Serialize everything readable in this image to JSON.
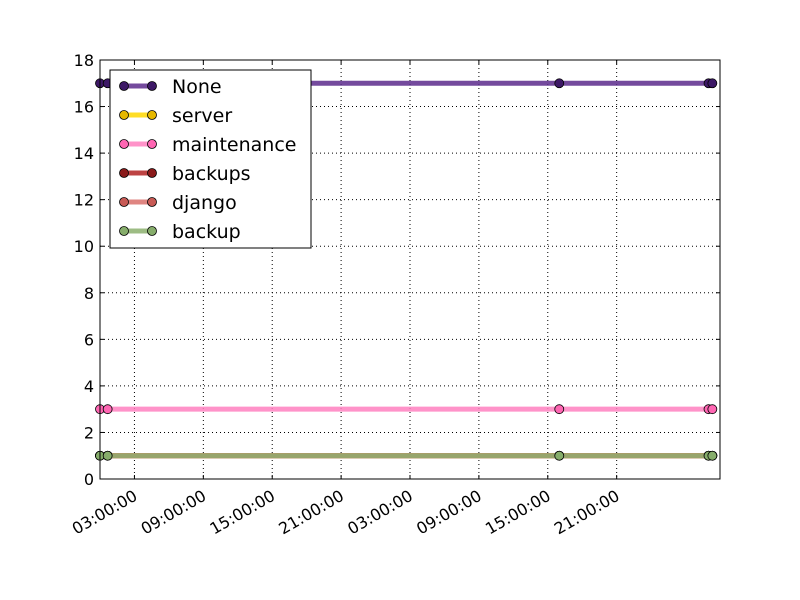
{
  "chart_data": {
    "type": "line",
    "title": "",
    "xlabel": "",
    "ylabel": "",
    "grid": true,
    "legend_position": "top-left",
    "ylim": [
      0,
      18
    ],
    "y_ticks": [
      0,
      2,
      4,
      6,
      8,
      10,
      12,
      14,
      16,
      18
    ],
    "xlim": [
      "2013-03-01T00:00:00",
      "2013-03-03T06:00:00"
    ],
    "x_ticks": [
      {
        "value": "2013-03-01T03:00:00",
        "label": "03:00:00"
      },
      {
        "value": "2013-03-01T09:00:00",
        "label": "09:00:00"
      },
      {
        "value": "2013-03-01T15:00:00",
        "label": "15:00:00"
      },
      {
        "value": "2013-03-01T21:00:00",
        "label": "21:00:00"
      },
      {
        "value": "2013-03-02T03:00:00",
        "label": "03:00:00"
      },
      {
        "value": "2013-03-02T09:00:00",
        "label": "09:00:00"
      },
      {
        "value": "2013-03-02T15:00:00",
        "label": "15:00:00"
      },
      {
        "value": "2013-03-02T21:00:00",
        "label": "21:00:00"
      }
    ],
    "series": [
      {
        "name": "None",
        "color": "#5c2a8c",
        "marker": "#3d1866",
        "x": [
          "2013-03-01T00:00:00",
          "2013-03-01T00:40:00",
          "2013-03-02T16:00:00",
          "2013-03-03T05:00:00",
          "2013-03-03T05:20:00"
        ],
        "y": [
          17,
          17,
          17,
          17,
          17
        ]
      },
      {
        "name": "server",
        "color": "#ffd700",
        "marker": "#e6b800",
        "x": [
          "2013-03-01T00:00:00",
          "2013-03-01T00:40:00",
          "2013-03-02T16:00:00",
          "2013-03-03T05:00:00",
          "2013-03-03T05:20:00"
        ],
        "y": [
          1,
          1,
          1,
          1,
          1
        ]
      },
      {
        "name": "maintenance",
        "color": "#ff80c0",
        "marker": "#ff66b3",
        "x": [
          "2013-03-01T00:00:00",
          "2013-03-01T00:40:00",
          "2013-03-02T16:00:00",
          "2013-03-03T05:00:00",
          "2013-03-03T05:20:00"
        ],
        "y": [
          3,
          3,
          3,
          3,
          3
        ]
      },
      {
        "name": "backups",
        "color": "#b22222",
        "marker": "#8b1a1a",
        "x": [
          "2013-03-01T00:00:00",
          "2013-03-01T00:40:00",
          "2013-03-02T16:00:00",
          "2013-03-03T05:00:00",
          "2013-03-03T05:20:00"
        ],
        "y": [
          1,
          1,
          1,
          1,
          1
        ]
      },
      {
        "name": "django",
        "color": "#d9706b",
        "marker": "#c85a55",
        "x": [
          "2013-03-01T00:00:00",
          "2013-03-01T00:40:00",
          "2013-03-02T16:00:00",
          "2013-03-03T05:00:00",
          "2013-03-03T05:20:00"
        ],
        "y": [
          1,
          1,
          1,
          1,
          1
        ]
      },
      {
        "name": "backup",
        "color": "#8cb06e",
        "marker": "#86ad6b",
        "x": [
          "2013-03-01T00:00:00",
          "2013-03-01T00:40:00",
          "2013-03-02T16:00:00",
          "2013-03-03T05:00:00",
          "2013-03-03T05:20:00"
        ],
        "y": [
          1,
          1,
          1,
          1,
          1
        ]
      }
    ]
  }
}
